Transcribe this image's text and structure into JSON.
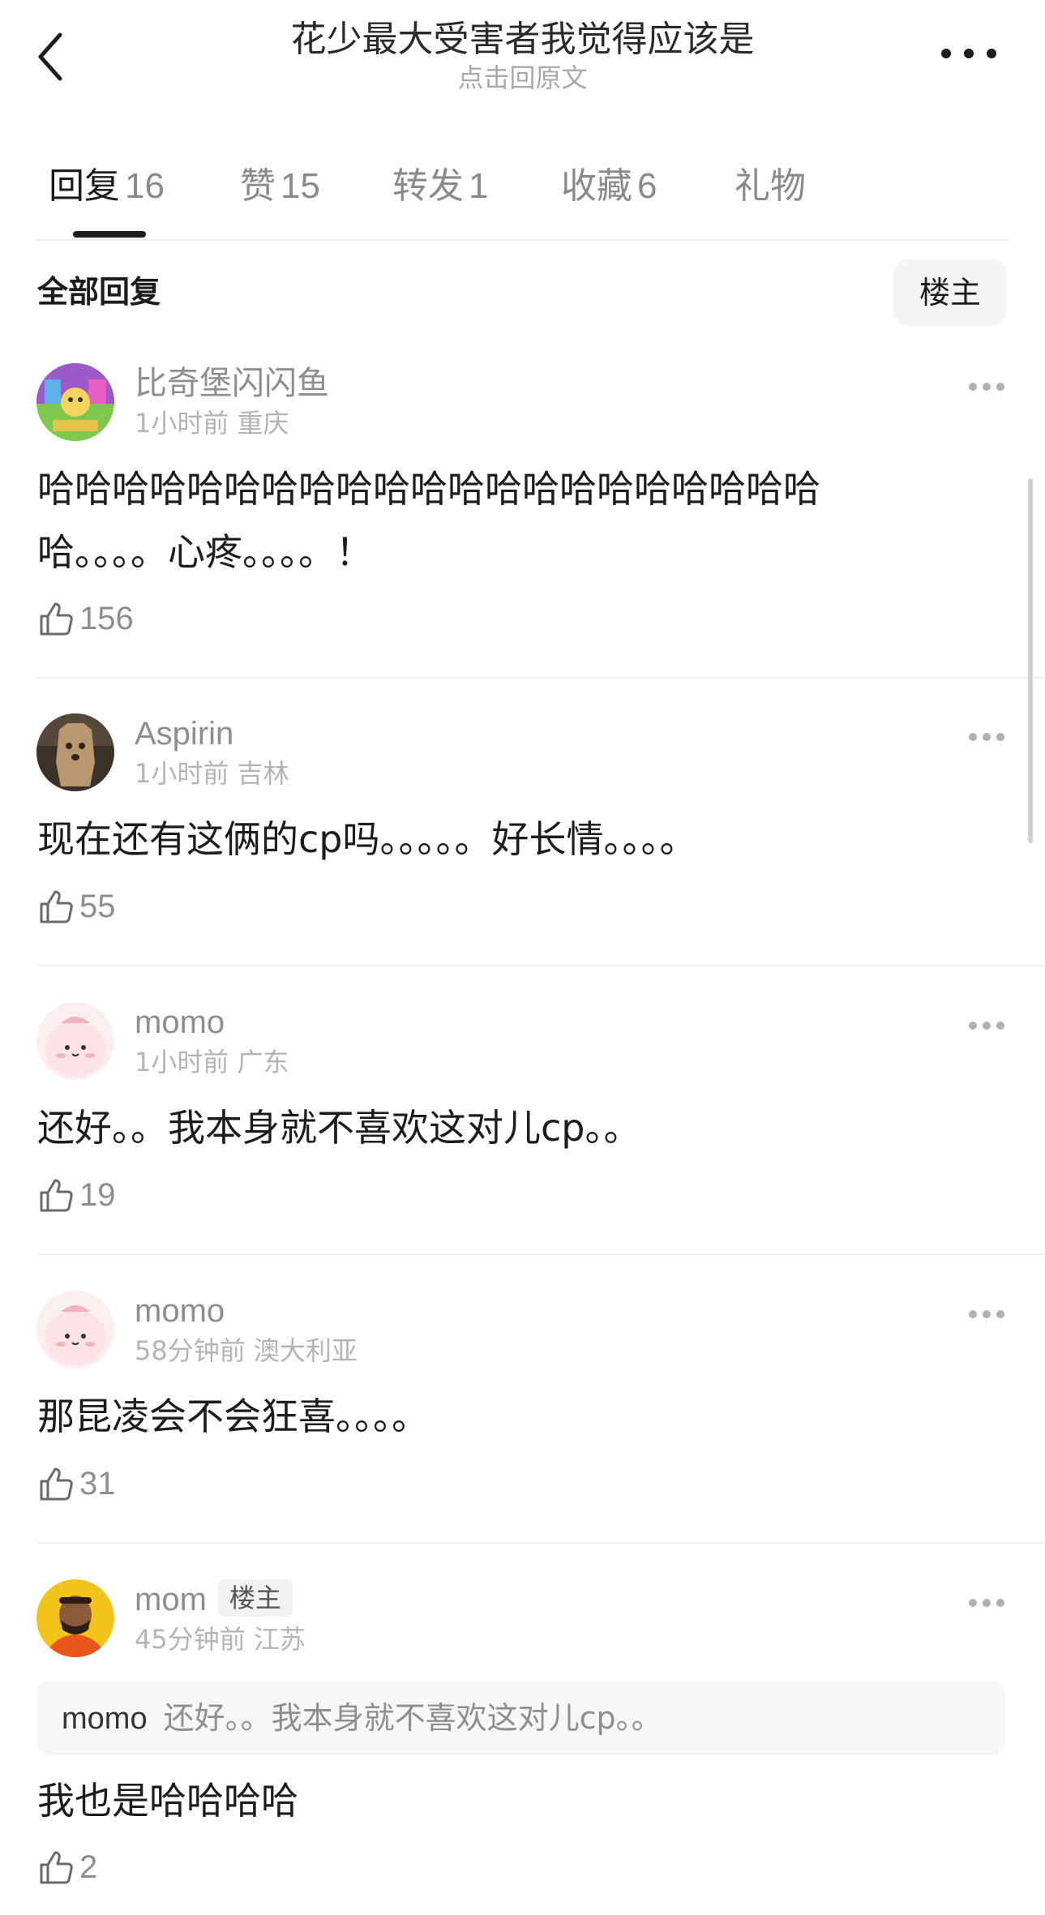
{
  "header": {
    "back_icon": "chevron-left-icon",
    "title": "花少最大受害者我觉得应该是",
    "subtitle": "点击回原文",
    "more_icon": "more-horizontal-icon"
  },
  "tabs": [
    {
      "label": "回复",
      "count": "16",
      "active": true
    },
    {
      "label": "赞",
      "count": "15",
      "active": false
    },
    {
      "label": "转发",
      "count": "1",
      "active": false
    },
    {
      "label": "收藏",
      "count": "6",
      "active": false
    },
    {
      "label": "礼物",
      "count": "",
      "active": false
    }
  ],
  "section": {
    "title": "全部回复",
    "filter_label": "楼主"
  },
  "comments": [
    {
      "username": "比奇堡闪闪鱼",
      "meta": "1小时前 重庆",
      "text_lines": [
        "哈哈哈哈哈哈哈哈哈哈哈哈哈哈哈哈哈哈哈哈哈",
        "哈。。。。心疼。。。。！"
      ],
      "likes": "156"
    },
    {
      "username": "Aspirin",
      "meta": "1小时前 吉林",
      "text_lines": [
        "现在还有这俩的cp吗。。。。。好长情。。。。"
      ],
      "likes": "55"
    },
    {
      "username": "momo",
      "meta": "1小时前 广东",
      "text_lines": [
        "还好。。我本身就不喜欢这对儿cp。。"
      ],
      "likes": "19"
    },
    {
      "username": "momo",
      "meta": "58分钟前 澳大利亚",
      "text_lines": [
        "那昆凌会不会狂喜。。。。"
      ],
      "likes": "31"
    },
    {
      "username": "mom",
      "badge": "楼主",
      "meta": "45分钟前 江苏",
      "quote": {
        "name": "momo",
        "text": "还好。。我本身就不喜欢这对儿cp。。"
      },
      "text_lines": [
        "我也是哈哈哈哈"
      ],
      "likes": "2"
    }
  ],
  "icons": {
    "like": "thumbs-up-icon",
    "more": "more-horizontal-icon"
  },
  "colors": {
    "text_primary": "#1c1c1c",
    "text_secondary": "#8e8e8e",
    "text_tertiary": "#b4b4b4"
  }
}
